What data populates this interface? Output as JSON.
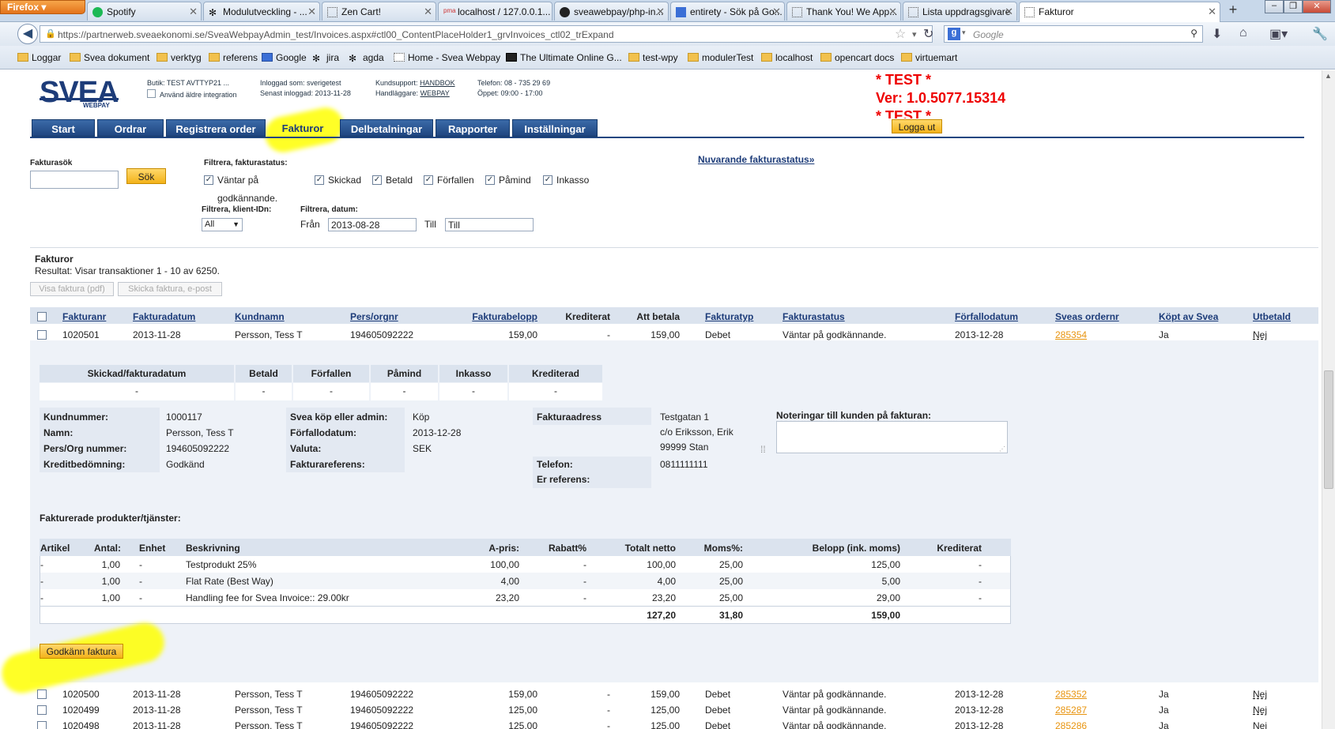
{
  "browser": {
    "app_button": "Firefox",
    "tabs": [
      {
        "label": "Spotify"
      },
      {
        "label": "Modulutveckling - ..."
      },
      {
        "label": "Zen Cart!"
      },
      {
        "label": "localhost / 127.0.0.1..."
      },
      {
        "label": "sveawebpay/php-in..."
      },
      {
        "label": "entirety - Sök på Go..."
      },
      {
        "label": "Thank You! We App..."
      },
      {
        "label": "Lista uppdragsgivare"
      },
      {
        "label": "Fakturor"
      }
    ],
    "url": "https://partnerweb.sveaekonomi.se/SveaWebpayAdmin_test/Invoices.aspx#ctl00_ContentPlaceHolder1_grvInvoices_ctl02_trExpand",
    "search_placeholder": "Google",
    "bookmarks": [
      "Loggar",
      "Svea dokument",
      "verktyg",
      "referens",
      "Google",
      "jira",
      "agda",
      "Home - Svea Webpay",
      "The Ultimate Online G...",
      "test-wpy",
      "modulerTest",
      "localhost",
      "opencart docs",
      "virtuemart"
    ]
  },
  "header": {
    "logo": "SVEA",
    "logo_sub": "WEBPAY",
    "butik": "Butik: TEST AVTTYP21 ...",
    "old_integration": "Använd äldre integration",
    "logged_in": "Inloggad som: sverigetest",
    "last_login": "Senast inloggad: 2013-11-28",
    "support_label": "Kundsupport:",
    "support_link": "HANDBOK",
    "handler_label": "Handläggare:",
    "handler_link": "WEBPAY",
    "phone": "Telefon: 08 - 735 29 69",
    "hours": "Öppet: 09:00 - 17:00",
    "test1": "* TEST *",
    "version": "Ver: 1.0.5077.15314",
    "test2": "* TEST *",
    "logout": "Logga ut"
  },
  "nav": [
    "Start",
    "Ordrar",
    "Registrera order",
    "Fakturor",
    "Delbetalningar",
    "Rapporter",
    "Inställningar"
  ],
  "filters": {
    "search_label": "Fakturasök",
    "search_button": "Sök",
    "status_label": "Filtrera, fakturastatus:",
    "status_first": "Väntar på",
    "status_first_cont": "godkännande.",
    "statuses": [
      "Skickad",
      "Betald",
      "Förfallen",
      "Påmind",
      "Inkasso"
    ],
    "client_label": "Filtrera, klient-IDn:",
    "client_value": "All",
    "date_label": "Filtrera, datum:",
    "from_label": "Från",
    "from_value": "2013-08-28",
    "to_label": "Till",
    "to_value": "Till",
    "current_status_link": "Nuvarande fakturastatus»"
  },
  "list": {
    "title": "Fakturor",
    "result": "Resultat: Visar transaktioner 1 - 10 av 6250.",
    "btn_pdf": "Visa faktura (pdf)",
    "btn_email": "Skicka faktura, e-post",
    "columns": [
      "Fakturanr",
      "Fakturadatum",
      "Kundnamn",
      "Pers/orgnr",
      "Fakturabelopp",
      "Krediterat",
      "Att betala",
      "Fakturatyp",
      "Fakturastatus",
      "Förfallodatum",
      "Sveas ordernr",
      "Köpt av Svea",
      "Utbetald"
    ],
    "rows": [
      [
        "1020501",
        "2013-11-28",
        "Persson, Tess T",
        "194605092222",
        "159,00",
        "-",
        "159,00",
        "Debet",
        "Väntar på godkännande.",
        "2013-12-28",
        "285354",
        "Ja",
        "Nej"
      ],
      [
        "1020500",
        "2013-11-28",
        "Persson, Tess T",
        "194605092222",
        "159,00",
        "-",
        "159,00",
        "Debet",
        "Väntar på godkännande.",
        "2013-12-28",
        "285352",
        "Ja",
        "Nej"
      ],
      [
        "1020499",
        "2013-11-28",
        "Persson, Tess T",
        "194605092222",
        "125,00",
        "-",
        "125,00",
        "Debet",
        "Väntar på godkännande.",
        "2013-12-28",
        "285287",
        "Ja",
        "Nej"
      ],
      [
        "1020498",
        "2013-11-28",
        "Persson, Tess T",
        "194605092222",
        "125,00",
        "-",
        "125,00",
        "Debet",
        "Väntar på godkännande.",
        "2013-12-28",
        "285286",
        "Ja",
        "Nej"
      ]
    ]
  },
  "detail": {
    "dates_headers": [
      "Skickad/fakturadatum",
      "Betald",
      "Förfallen",
      "Påmind",
      "Inkasso",
      "Krediterad"
    ],
    "dates_values": [
      "-",
      "-",
      "-",
      "-",
      "-",
      "-"
    ],
    "customer": {
      "k1": "Kundnummer:",
      "v1": "1000117",
      "k2": "Namn:",
      "v2": "Persson, Tess T",
      "k3": "Pers/Org nummer:",
      "v3": "194605092222",
      "k4": "Kreditbedömning:",
      "v4": "Godkänd"
    },
    "order": {
      "k1": "Svea köp eller admin:",
      "v1": "Köp",
      "k2": "Förfallodatum:",
      "v2": "2013-12-28",
      "k3": "Valuta:",
      "v3": "SEK",
      "k4": "Fakturareferens:",
      "v4": ""
    },
    "address": {
      "label": "Fakturaadress",
      "line1": "Testgatan 1",
      "line2": "c/o Eriksson, Erik",
      "line3": "99999 Stan",
      "phone_label": "Telefon:",
      "phone": "0811111111",
      "ref_label": "Er referens:"
    },
    "notes_label": "Noteringar till kunden på fakturan:",
    "products_title": "Fakturerade produkter/tjänster:",
    "product_columns": [
      "Artikel",
      "Antal:",
      "Enhet",
      "Beskrivning",
      "A-pris:",
      "Rabatt%",
      "Totalt netto",
      "Moms%:",
      "Belopp (ink. moms)",
      "Krediterat"
    ],
    "products": [
      [
        "-",
        "1,00",
        "-",
        "Testprodukt 25%",
        "100,00",
        "-",
        "100,00",
        "25,00",
        "125,00",
        "-"
      ],
      [
        "-",
        "1,00",
        "-",
        "Flat Rate (Best Way)",
        "4,00",
        "-",
        "4,00",
        "25,00",
        "5,00",
        "-"
      ],
      [
        "-",
        "1,00",
        "-",
        "Handling fee for Svea Invoice:: 29.00kr",
        "23,20",
        "-",
        "23,20",
        "25,00",
        "29,00",
        "-"
      ]
    ],
    "totals": {
      "netto": "127,20",
      "moms": "31,80",
      "belopp": "159,00"
    },
    "approve_button": "Godkänn faktura"
  }
}
